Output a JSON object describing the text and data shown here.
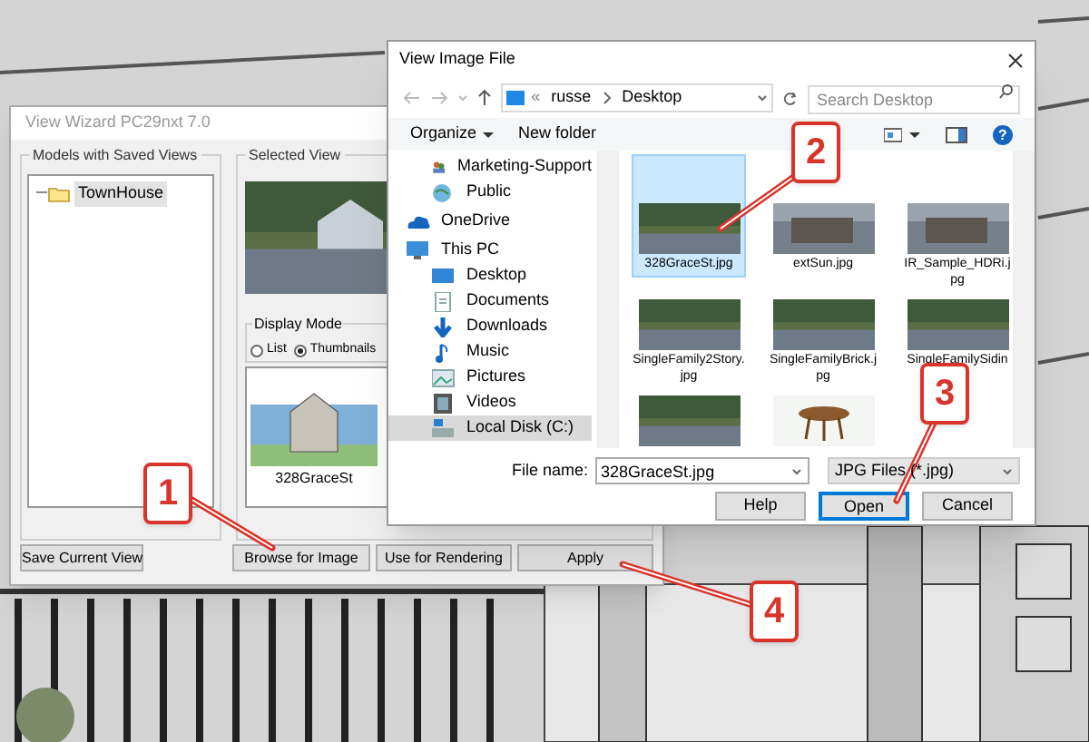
{
  "wizard": {
    "title": "View Wizard PC29nxt 7.0",
    "models_group": "Models with Saved Views",
    "tree": [
      {
        "label": "TownHouse",
        "selected": true
      }
    ],
    "selected_view_group": "Selected View",
    "display_mode": {
      "label": "Display Mode",
      "options": [
        {
          "label": "List",
          "selected": false
        },
        {
          "label": "Thumbnails",
          "selected": true
        }
      ]
    },
    "thumbnails": [
      {
        "label": "328GraceSt"
      }
    ],
    "buttons": [
      "Save Current View",
      "Browse for Image",
      "Use for Rendering",
      "Apply"
    ]
  },
  "dialog": {
    "title": "View Image File",
    "address": {
      "overflow": "«",
      "crumbs": [
        "russe",
        "Desktop"
      ]
    },
    "search": {
      "placeholder": "Search Desktop"
    },
    "toolbar": [
      "Organize",
      "New folder"
    ],
    "help_icon": "?",
    "nav": [
      {
        "label": "Marketing-Support",
        "kind": "users",
        "selected": false
      },
      {
        "label": "Public",
        "kind": "network",
        "selected": false
      },
      {
        "label": "OneDrive",
        "kind": "cloud",
        "selected": false
      },
      {
        "label": "This PC",
        "kind": "pc",
        "selected": false
      },
      {
        "label": "Desktop",
        "kind": "desktop",
        "selected": false
      },
      {
        "label": "Documents",
        "kind": "documents",
        "selected": false
      },
      {
        "label": "Downloads",
        "kind": "downloads",
        "selected": false
      },
      {
        "label": "Music",
        "kind": "music",
        "selected": false
      },
      {
        "label": "Pictures",
        "kind": "pictures",
        "selected": false
      },
      {
        "label": "Videos",
        "kind": "videos",
        "selected": false
      },
      {
        "label": "Local Disk (C:)",
        "kind": "disk",
        "selected": true
      }
    ],
    "files": [
      {
        "label": "328GraceSt.jpg",
        "kind": "house",
        "selected": true
      },
      {
        "label": "extSun.jpg",
        "kind": "building",
        "selected": false
      },
      {
        "label": "IR_Sample_HDRi.jpg",
        "kind": "building",
        "selected": false
      },
      {
        "label": "SingleFamily2Story.jpg",
        "kind": "house",
        "selected": false
      },
      {
        "label": "SingleFamilyBrick.jpg",
        "kind": "house",
        "selected": false
      },
      {
        "label": "SingleFamilySidin",
        "kind": "house",
        "selected": false
      },
      {
        "kind": "house",
        "selected": false
      },
      {
        "kind": "table",
        "selected": false
      }
    ],
    "file_name": {
      "label": "File name:",
      "value": "328GraceSt.jpg"
    },
    "filter": "JPG Files (*.jpg)",
    "buttons": [
      {
        "label": "Help",
        "focused": false
      },
      {
        "label": "Open",
        "focused": true
      },
      {
        "label": "Cancel",
        "focused": false
      }
    ]
  },
  "callouts": [
    {
      "number": "1"
    },
    {
      "number": "2"
    },
    {
      "number": "3"
    },
    {
      "number": "4"
    }
  ]
}
